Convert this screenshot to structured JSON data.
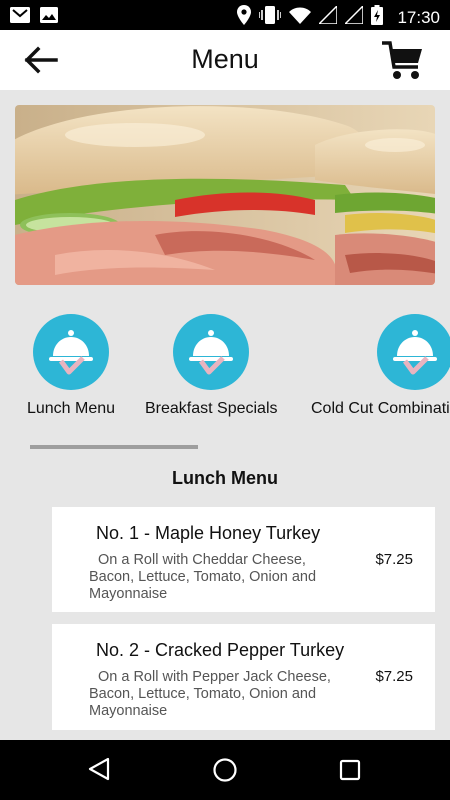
{
  "status_bar": {
    "time": "17:30",
    "left_icons": [
      "gmail-icon",
      "image-icon"
    ],
    "right_icons": [
      "location-icon",
      "vibrate-icon",
      "wifi-icon",
      "signal-icon",
      "signal-icon",
      "battery-charging-icon"
    ]
  },
  "app_bar": {
    "title": "Menu",
    "back_icon": "arrow-left-icon",
    "cart_icon": "cart-icon"
  },
  "banner": {
    "image": "sandwich-photo"
  },
  "categories": [
    {
      "label": "Lunch Menu",
      "icon": "food-tray-icon"
    },
    {
      "label": "Breakfast Specials",
      "icon": "food-tray-icon"
    },
    {
      "label": "Cold Cut Combination",
      "icon": "food-tray-icon"
    }
  ],
  "section": {
    "heading": "Lunch Menu"
  },
  "items": [
    {
      "name": "No. 1 - Maple Honey Turkey",
      "description": "On a Roll with Cheddar Cheese, Bacon, Lettuce, Tomato, Onion and Mayonnaise",
      "price": "$7.25"
    },
    {
      "name": "No. 2 - Cracked Pepper Turkey",
      "description": "On a Roll with Pepper Jack Cheese, Bacon, Lettuce, Tomato, Onion and Mayonnaise",
      "price": "$7.25"
    }
  ],
  "colors": {
    "accent": "#2db6d6",
    "background": "#e6e6e6",
    "status_bar": "#000000"
  }
}
